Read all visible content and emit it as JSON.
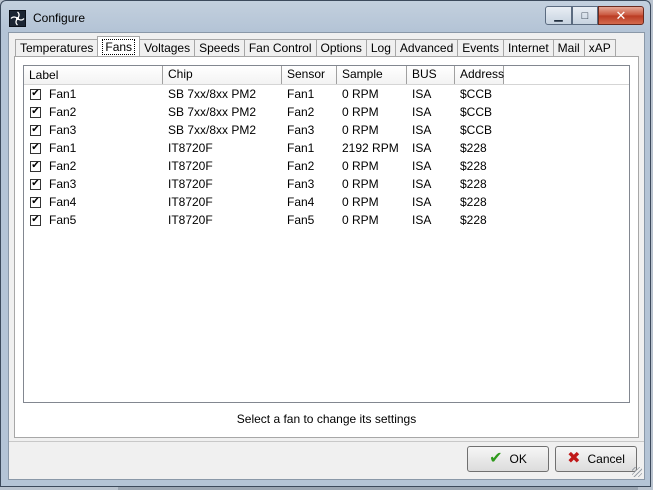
{
  "window": {
    "title": "Configure"
  },
  "tabs": [
    {
      "label": "Temperatures",
      "active": false
    },
    {
      "label": "Fans",
      "active": true
    },
    {
      "label": "Voltages",
      "active": false
    },
    {
      "label": "Speeds",
      "active": false
    },
    {
      "label": "Fan Control",
      "active": false
    },
    {
      "label": "Options",
      "active": false
    },
    {
      "label": "Log",
      "active": false
    },
    {
      "label": "Advanced",
      "active": false
    },
    {
      "label": "Events",
      "active": false
    },
    {
      "label": "Internet",
      "active": false
    },
    {
      "label": "Mail",
      "active": false
    },
    {
      "label": "xAP",
      "active": false
    }
  ],
  "table": {
    "columns": [
      "Label",
      "Chip",
      "Sensor",
      "Sample",
      "BUS",
      "Address"
    ],
    "rows": [
      {
        "checked": true,
        "label": "Fan1",
        "chip": "SB 7xx/8xx PM2",
        "sensor": "Fan1",
        "sample": "0 RPM",
        "bus": "ISA",
        "address": "$CCB"
      },
      {
        "checked": true,
        "label": "Fan2",
        "chip": "SB 7xx/8xx PM2",
        "sensor": "Fan2",
        "sample": "0 RPM",
        "bus": "ISA",
        "address": "$CCB"
      },
      {
        "checked": true,
        "label": "Fan3",
        "chip": "SB 7xx/8xx PM2",
        "sensor": "Fan3",
        "sample": "0 RPM",
        "bus": "ISA",
        "address": "$CCB"
      },
      {
        "checked": true,
        "label": "Fan1",
        "chip": "IT8720F",
        "sensor": "Fan1",
        "sample": "2192 RPM",
        "bus": "ISA",
        "address": "$228"
      },
      {
        "checked": true,
        "label": "Fan2",
        "chip": "IT8720F",
        "sensor": "Fan2",
        "sample": "0 RPM",
        "bus": "ISA",
        "address": "$228"
      },
      {
        "checked": true,
        "label": "Fan3",
        "chip": "IT8720F",
        "sensor": "Fan3",
        "sample": "0 RPM",
        "bus": "ISA",
        "address": "$228"
      },
      {
        "checked": true,
        "label": "Fan4",
        "chip": "IT8720F",
        "sensor": "Fan4",
        "sample": "0 RPM",
        "bus": "ISA",
        "address": "$228"
      },
      {
        "checked": true,
        "label": "Fan5",
        "chip": "IT8720F",
        "sensor": "Fan5",
        "sample": "0 RPM",
        "bus": "ISA",
        "address": "$228"
      }
    ]
  },
  "status_text": "Select a fan to change its settings",
  "buttons": {
    "ok": "OK",
    "cancel": "Cancel"
  },
  "icons": {
    "app": "speedfan-icon",
    "ok": "checkmark-icon",
    "cancel": "x-icon"
  },
  "colors": {
    "ok_icon": "#2f9a1c",
    "cancel_icon": "#c01818",
    "close_button": "#c8533a"
  }
}
